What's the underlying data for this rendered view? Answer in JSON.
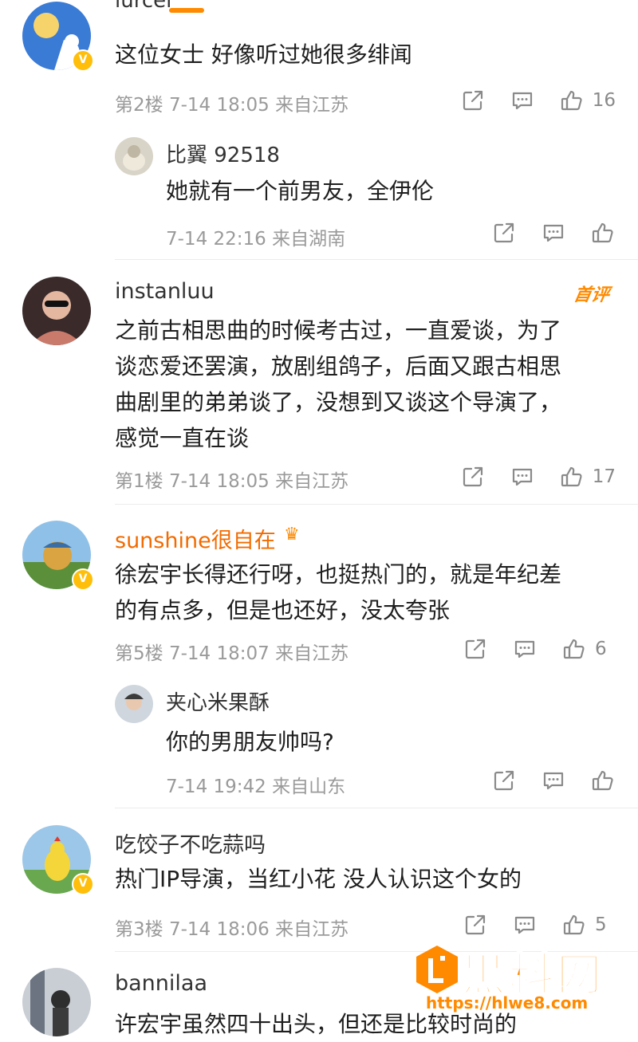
{
  "top": {
    "cut_username": "lurcel"
  },
  "comments": [
    {
      "text": "这位女士 好像听过她很多绯闻",
      "floor": "第2楼",
      "time": "7-14 18:05",
      "location": "来自江苏",
      "like_count": "16",
      "reply": {
        "username": "比翼 92518",
        "text": "她就有一个前男友，全伊伦",
        "time": "7-14 22:16",
        "location": "来自湖南"
      }
    },
    {
      "username": "instanluu",
      "badge": "首评",
      "lines": [
        "之前古相思曲的时候考古过，一直爱谈，为了",
        "谈恋爱还罢演，放剧组鸽子，后面又跟古相思",
        "曲剧里的弟弟谈了，没想到又谈这个导演了，",
        "感觉一直在谈"
      ],
      "floor": "第1楼",
      "time": "7-14 18:05",
      "location": "来自江苏",
      "like_count": "17"
    },
    {
      "username": "sunshine很自在",
      "lines": [
        "徐宏宇长得还行呀，也挺热门的，就是年纪差",
        "的有点多，但是也还好，没太夸张"
      ],
      "floor": "第5楼",
      "time": "7-14 18:07",
      "location": "来自江苏",
      "like_count": "6",
      "reply": {
        "username": "夹心米果酥",
        "text": "你的男朋友帅吗?",
        "time": "7-14 19:42",
        "location": "来自山东"
      }
    },
    {
      "username": "吃饺子不吃蒜吗",
      "text": "热门IP导演，当红小花 没人认识这个女的",
      "floor": "第3楼",
      "time": "7-14 18:06",
      "location": "来自江苏",
      "like_count": "5"
    },
    {
      "username": "bannilaa",
      "text": "许宏宇虽然四十出头，但还是比较时尚的"
    }
  ],
  "watermark": {
    "title": "黑料网",
    "url": "https://hlwe8.com"
  },
  "colors": {
    "accent": "#ff8a00",
    "meta": "#9a9a9a",
    "vip": "#ffbe0a"
  },
  "icons": {
    "share": "share-icon",
    "comment": "comment-icon",
    "like": "like-icon",
    "verified": "verified-badge-icon"
  }
}
